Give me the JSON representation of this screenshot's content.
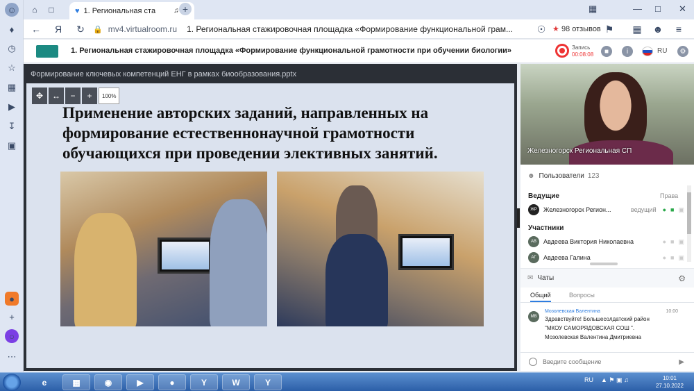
{
  "browser": {
    "tab_title": "1. Региональная ста",
    "url_host": "mv4.virtualroom.ru",
    "page_title": "1. Региональная стажировочная площадка «Формирование функциональной грам...",
    "reviews": "98 отзывов"
  },
  "app": {
    "title": "1. Региональная стажировочная площадка «Формирование функциональной грамотности при обучении биологии»",
    "record_label": "Запись",
    "record_time": "00:08:08",
    "lang": "RU"
  },
  "presentation": {
    "file_name": "Формирование ключевых компетенций ЕНГ в рамках биообразования.pptx",
    "zoom": "100%",
    "slide_title": "Применение авторских заданий, направленных на формирование естественнонаучной грамотности обучающихся при проведении элективных занятий."
  },
  "video": {
    "speaker_name": "Железногорск Региональная СП"
  },
  "users": {
    "header": "Пользователи",
    "count": "123",
    "hosts_label": "Ведущие",
    "rights_label": "Права",
    "hosts": [
      {
        "initials": "ЖР",
        "name": "Железногорск Регион...",
        "role": "ведущий"
      }
    ],
    "participants_label": "Участники",
    "participants": [
      {
        "initials": "АВ",
        "name": "Авдеева Виктория Николаевна"
      },
      {
        "initials": "АГ",
        "name": "Авдеева Галина"
      }
    ]
  },
  "chat": {
    "header": "Чаты",
    "tabs": [
      "Общий",
      "Вопросы"
    ],
    "message": {
      "initials": "МВ",
      "author": "Мозолевская Валентина",
      "time": "10:00",
      "lines": [
        "Здравствуйте! Большесолдатский район",
        "\"МКОУ САМОРЯДОВСКАЯ СОШ \".",
        "Мозолевская Валентина Дмитриевна"
      ]
    },
    "input_placeholder": "Введите сообщение"
  },
  "taskbar": {
    "lang": "RU",
    "time": "10:01",
    "date": "27.10.2022"
  }
}
